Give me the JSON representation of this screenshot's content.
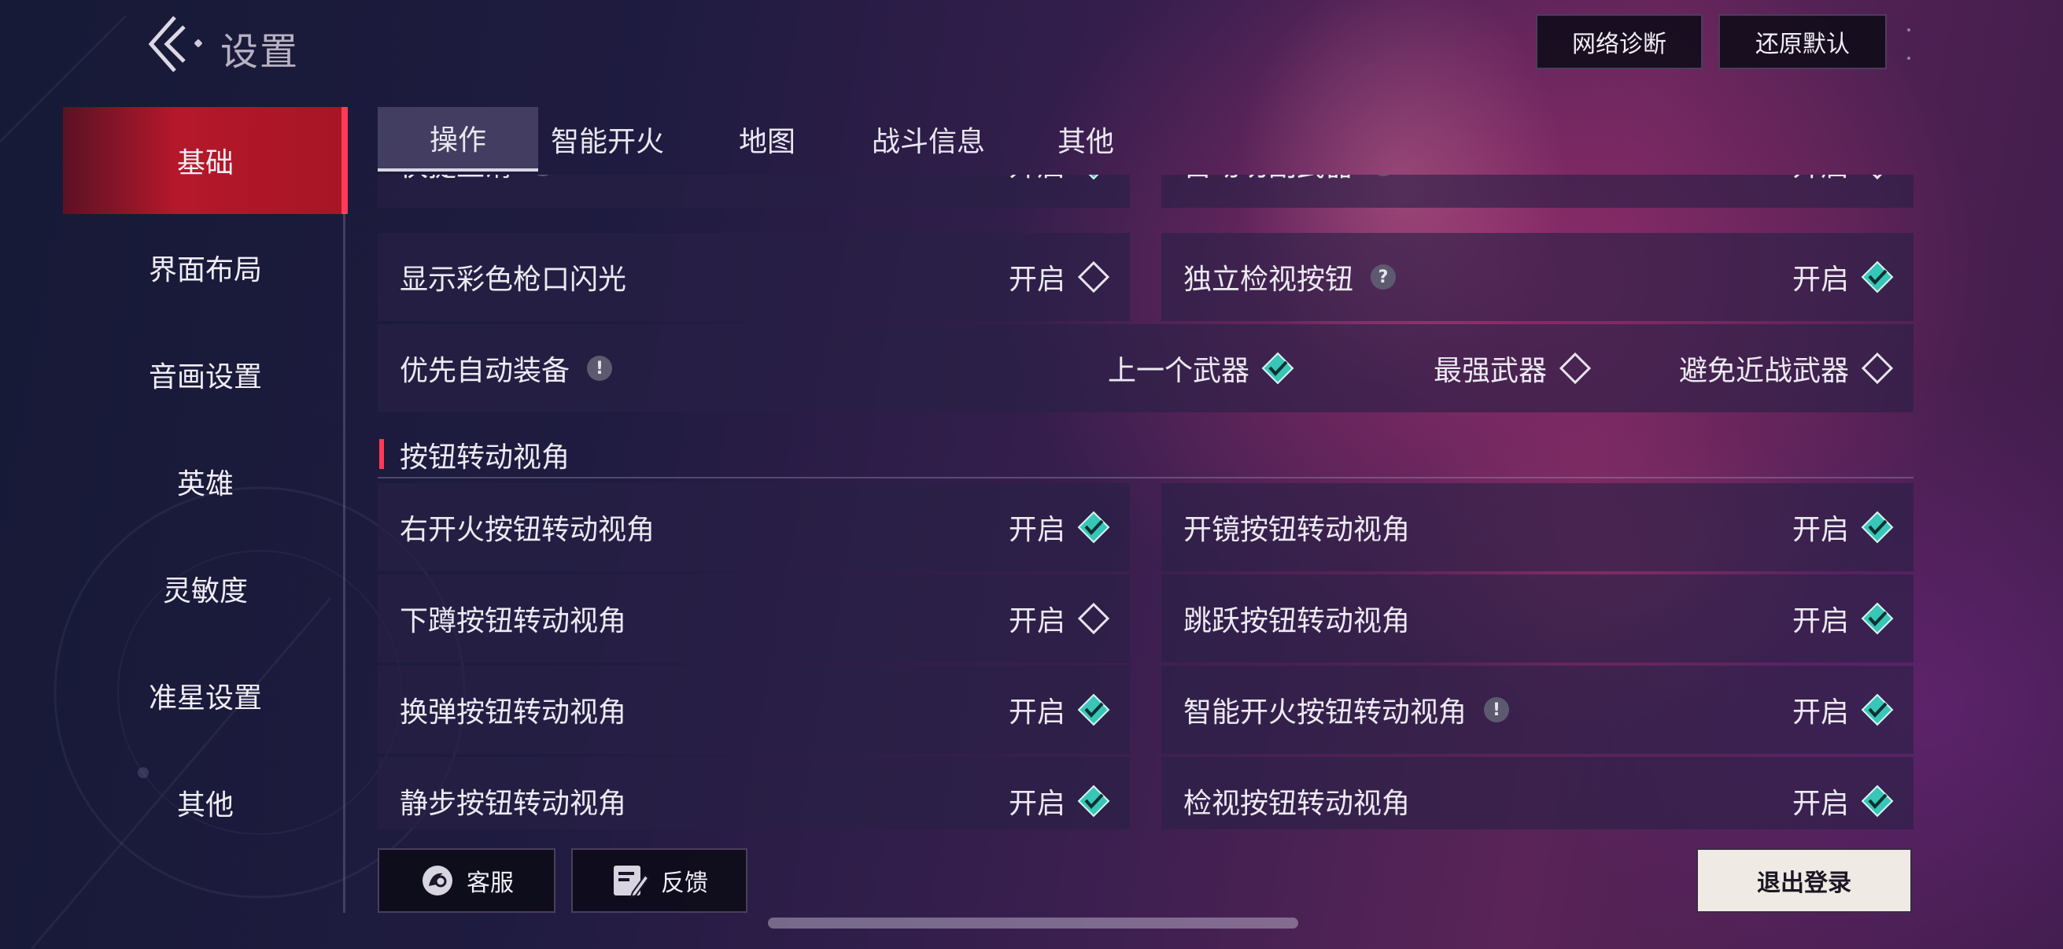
{
  "header": {
    "title": "设置",
    "buttons": {
      "network": "网络诊断",
      "reset": "还原默认"
    }
  },
  "sidebar": {
    "items": [
      {
        "label": "基础",
        "active": true
      },
      {
        "label": "界面布局"
      },
      {
        "label": "音画设置"
      },
      {
        "label": "英雄"
      },
      {
        "label": "灵敏度"
      },
      {
        "label": "准星设置"
      },
      {
        "label": "其他"
      }
    ]
  },
  "tabs": [
    {
      "label": "操作",
      "active": true
    },
    {
      "label": "智能开火"
    },
    {
      "label": "地图"
    },
    {
      "label": "战斗信息"
    },
    {
      "label": "其他"
    }
  ],
  "rows": {
    "r0": {
      "left": {
        "label": "快捷上滑",
        "value": "开启",
        "checked": true,
        "badge": "!"
      },
      "right": {
        "label": "自动切副武器",
        "value": "开启",
        "checked": false,
        "badge": "?"
      }
    },
    "r1": {
      "left": {
        "label": "显示彩色枪口闪光",
        "value": "开启",
        "checked": false
      },
      "right": {
        "label": "独立检视按钮",
        "value": "开启",
        "checked": true,
        "badge": "?"
      }
    },
    "r2": {
      "label": "优先自动装备",
      "badge": "!",
      "options": [
        {
          "label": "上一个武器",
          "checked": true
        },
        {
          "label": "最强武器",
          "checked": false
        },
        {
          "label": "避免近战武器",
          "checked": false
        }
      ]
    },
    "section_title": "按钮转动视角",
    "r3": {
      "left": {
        "label": "右开火按钮转动视角",
        "value": "开启",
        "checked": true
      },
      "right": {
        "label": "开镜按钮转动视角",
        "value": "开启",
        "checked": true
      }
    },
    "r4": {
      "left": {
        "label": "下蹲按钮转动视角",
        "value": "开启",
        "checked": false
      },
      "right": {
        "label": "跳跃按钮转动视角",
        "value": "开启",
        "checked": true
      }
    },
    "r5": {
      "left": {
        "label": "换弹按钮转动视角",
        "value": "开启",
        "checked": true
      },
      "right": {
        "label": "智能开火按钮转动视角",
        "value": "开启",
        "checked": true,
        "badge": "!"
      }
    },
    "r6": {
      "left": {
        "label": "静步按钮转动视角",
        "value": "开启",
        "checked": true
      },
      "right": {
        "label": "检视按钮转动视角",
        "value": "开启",
        "checked": true
      }
    }
  },
  "footer": {
    "customer_service": "客服",
    "feedback": "反馈",
    "logout": "退出登录"
  },
  "colors": {
    "accent_red": "#ff3a55",
    "active_tab_red": "#b5182a",
    "check_teal": "#37c6b8"
  }
}
